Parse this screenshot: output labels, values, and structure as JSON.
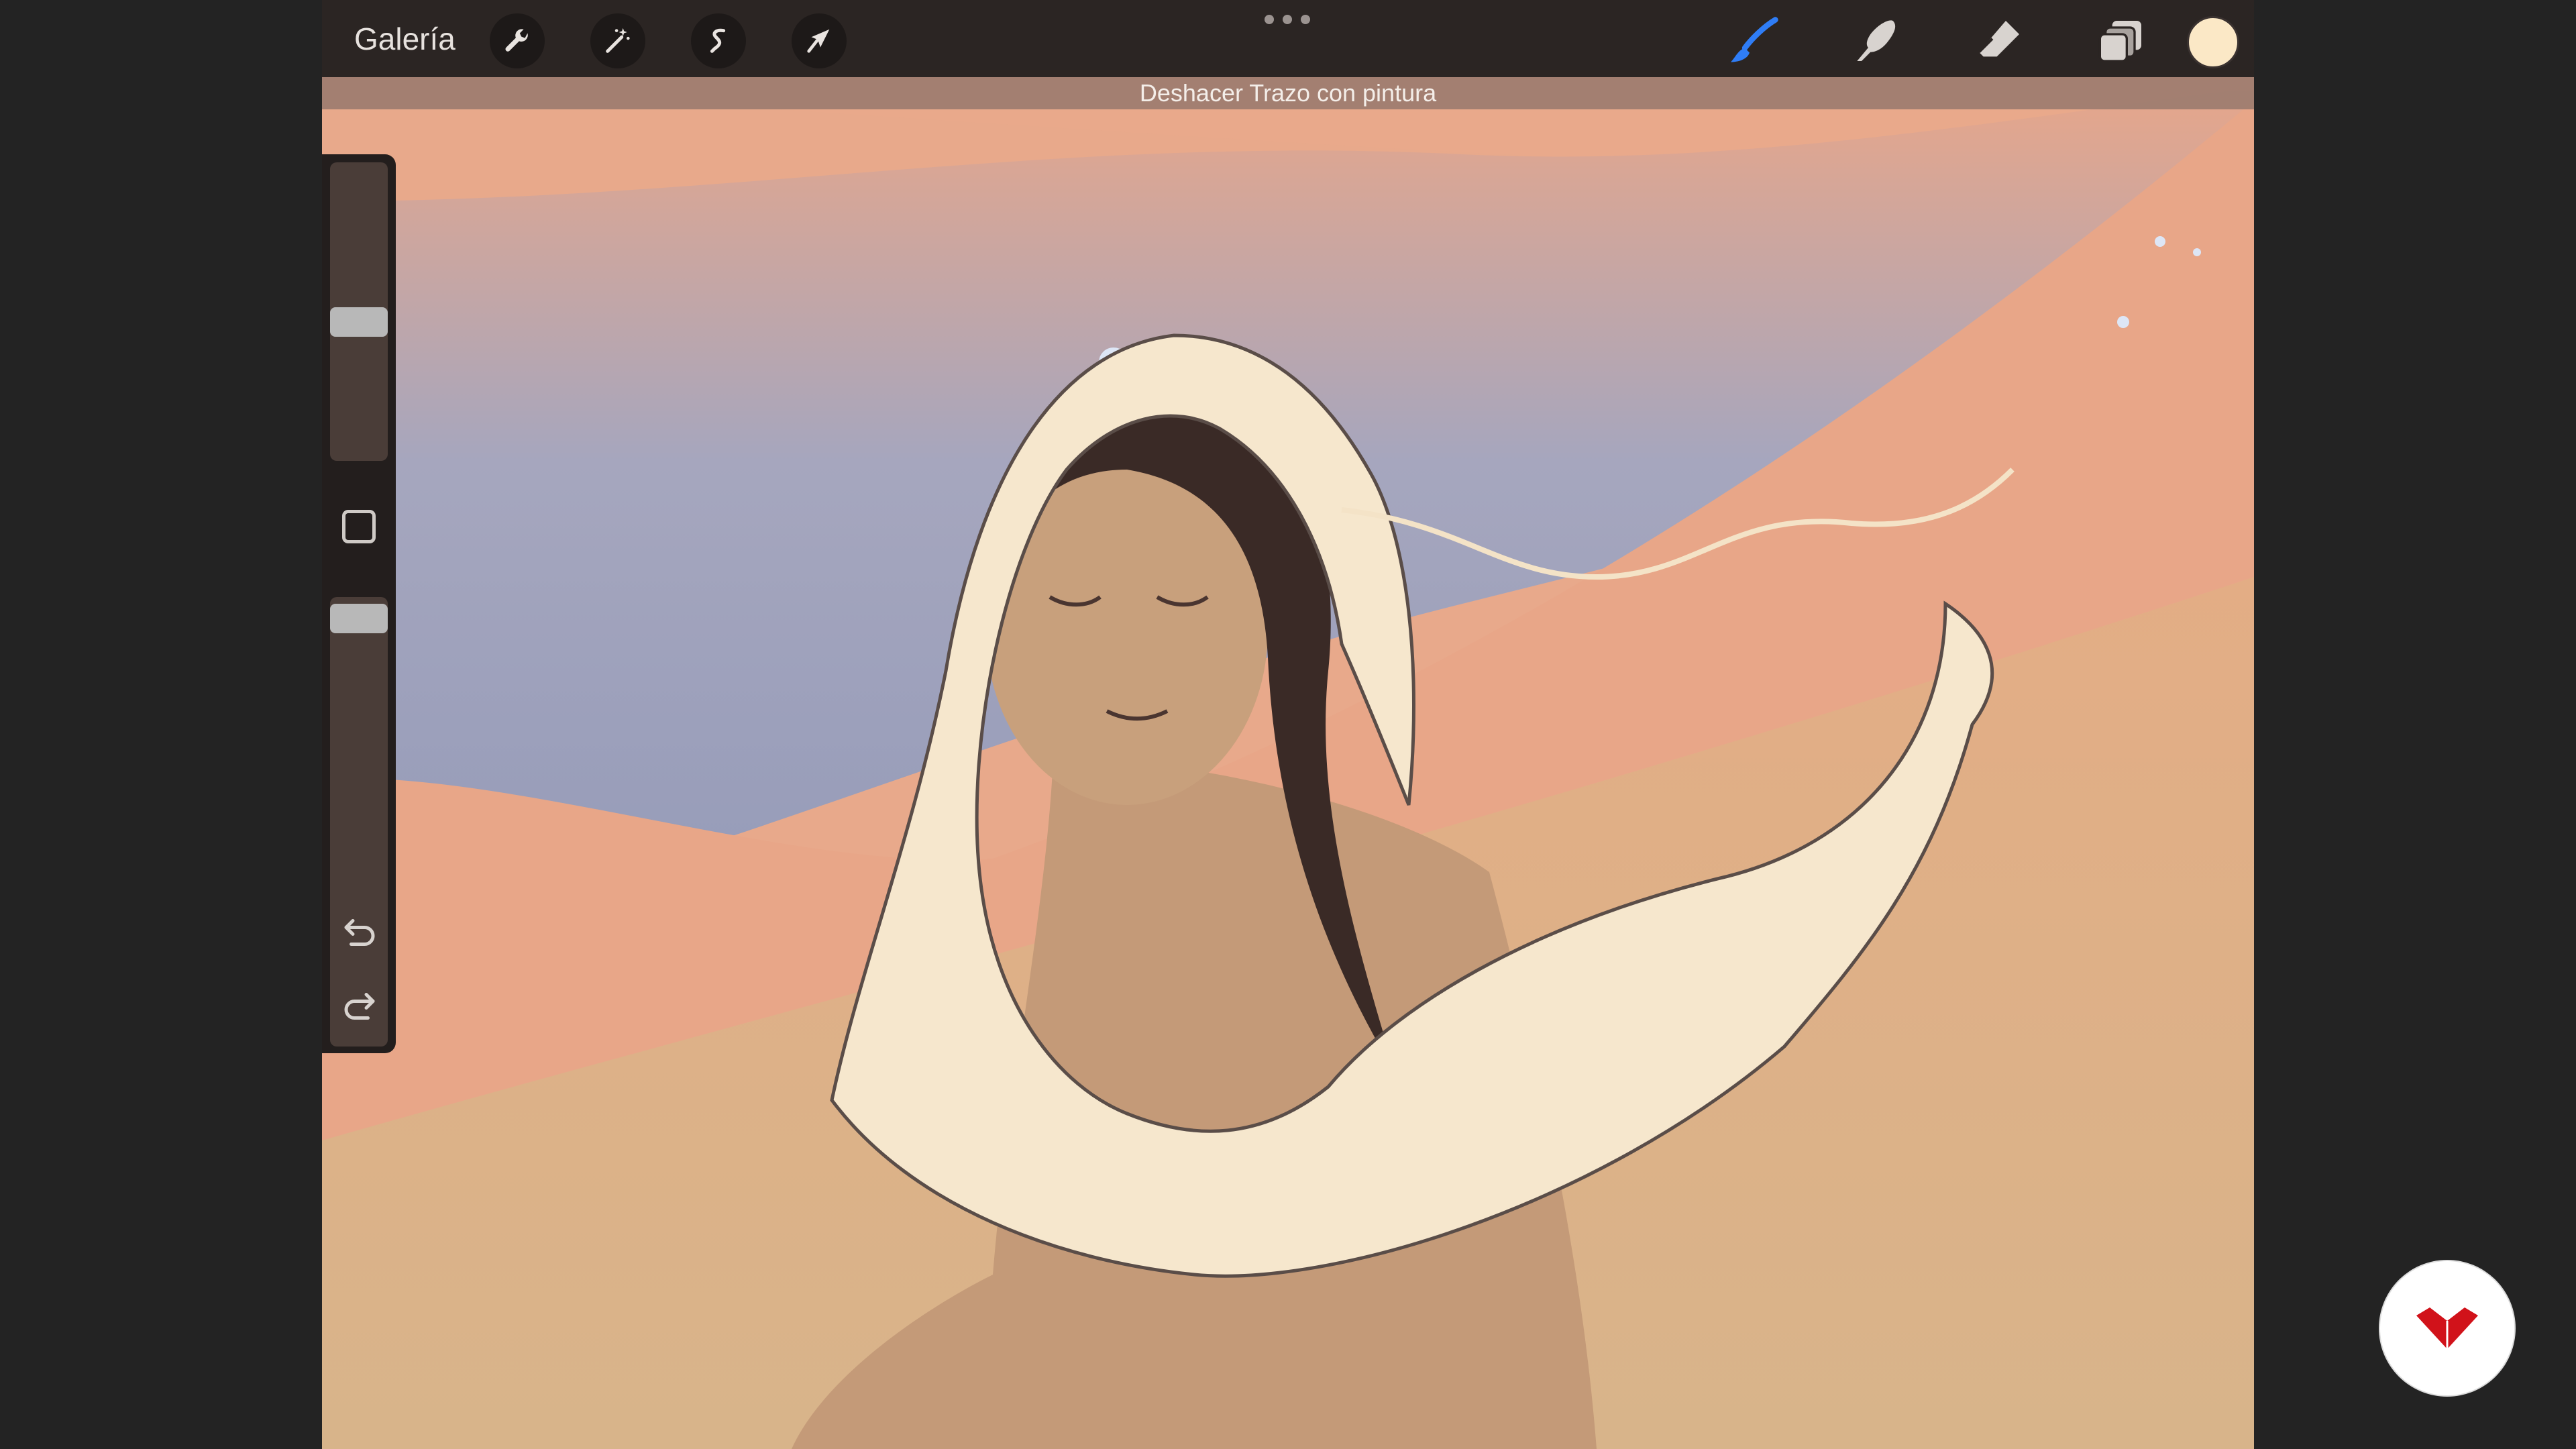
{
  "toolbar": {
    "gallery_label": "Galería",
    "left_tools": [
      "wrench-icon",
      "magic-wand-icon",
      "selection-icon",
      "transform-arrow-icon"
    ],
    "right_tools": [
      "brush-icon",
      "smudge-icon",
      "eraser-icon",
      "layers-icon"
    ],
    "active_tool": "brush",
    "active_tool_color": "#2f7df6",
    "current_color": "#fbe8c6"
  },
  "notice": {
    "text": "Deshacer Trazo con pintura"
  },
  "sidebar": {
    "brush_size_level": 0.55,
    "opacity_level": 0.92,
    "icons": [
      "modify-square-icon",
      "undo-icon",
      "redo-icon"
    ]
  },
  "colors": {
    "sky_blue": "#8a9bc2",
    "dune_peach": "#e9a889",
    "sand": "#d9b98e",
    "skin": "#c49a78",
    "shawl": "#f6e7cd",
    "hair": "#3a2a26"
  }
}
